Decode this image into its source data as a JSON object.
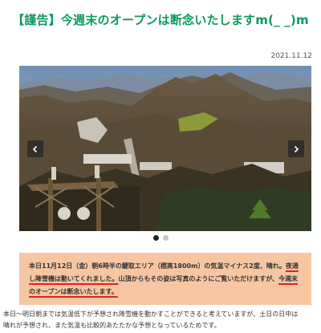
{
  "page": {
    "title": "【謹告】今週末のオープンは断念いたしますm(_ _)m",
    "date": "2021.11.12"
  },
  "slider": {
    "image_description": "photo",
    "prev_icon": "chevron-left-icon",
    "next_icon": "chevron-right-icon",
    "slide_count": 2,
    "active_slide": 1
  },
  "notice": {
    "part1": "本日11月12日（金）朝6時半の鍵取エリア（標高1800m）の気温マイナス2度、晴れ。",
    "part2": "夜通し降雪機は動いてくれました。",
    "part3": "山頂からもその姿は写真のようにご覧いただけますが、",
    "part4": "今週末のオープンは断念いたします。"
  },
  "body": {
    "line1": "本日〜明日朝までは気温低下が予想され降雪機を動かすことができると考えていますが、土日の日中は",
    "line2": "晴れが予想され、また気温も比較的あたたかな予想となっているためです。"
  },
  "colors": {
    "title": "#0c9a5b",
    "notice_bg": "#f6c6a3",
    "underline": "#e22020"
  }
}
